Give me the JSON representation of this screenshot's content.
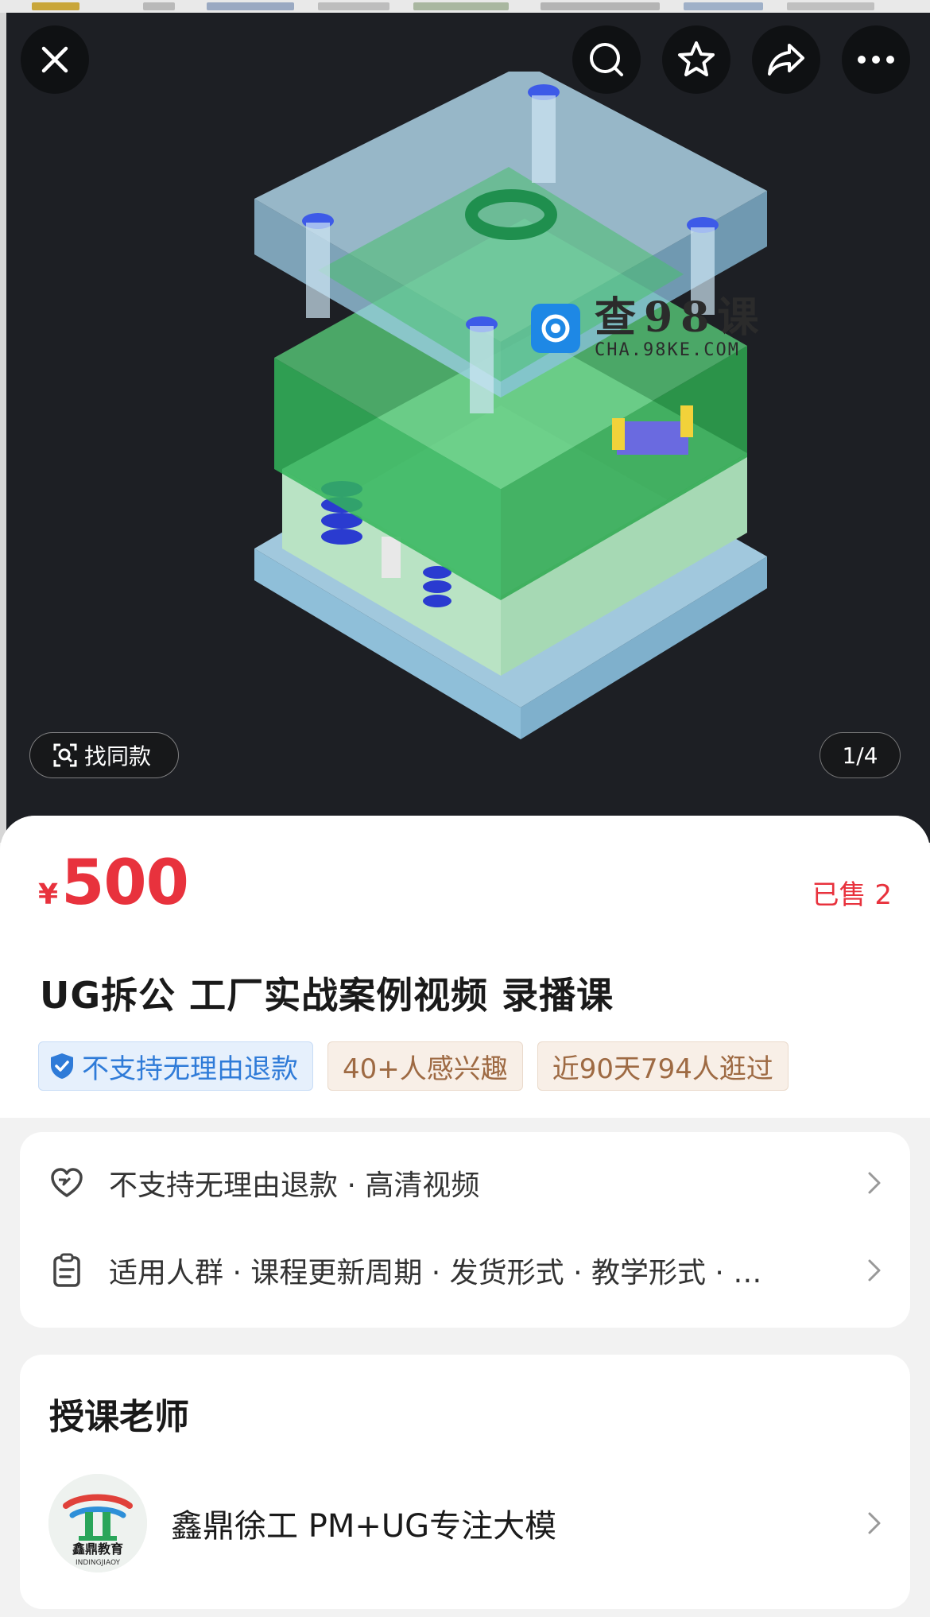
{
  "hero": {
    "find_same_label": "找同款",
    "pager": "1/4",
    "watermark": {
      "title": "查98课",
      "sub": "CHA.98KE.COM"
    }
  },
  "product": {
    "currency": "¥",
    "price": "500",
    "sold": "已售 2",
    "title": "UG拆公 工厂实战案例视频 录播课",
    "tags": [
      {
        "label": "不支持无理由退款"
      },
      {
        "label": "40+人感兴趣"
      },
      {
        "label": "近90天794人逛过"
      }
    ]
  },
  "service": {
    "rows": [
      {
        "text": "不支持无理由退款 · 高清视频"
      },
      {
        "text": "适用人群 · 课程更新周期 · 发货形式 · 教学形式 · …"
      }
    ]
  },
  "teacher": {
    "heading": "授课老师",
    "name": "鑫鼎徐工 PM+UG专注大模",
    "avatar_text": "鑫鼎教育",
    "avatar_sub": "INDINGJIAOY"
  },
  "colors": {
    "price": "#e8323d",
    "tag_blue": "#2f7bd8",
    "tag_gold": "#9e6a43",
    "hero_bg": "#1d1f24"
  },
  "icons": [
    "close-icon",
    "search-icon",
    "star-icon",
    "share-icon",
    "more-icon",
    "scan-search-icon",
    "shield-check-icon",
    "heart-service-icon",
    "clipboard-icon",
    "chevron-right-icon"
  ]
}
